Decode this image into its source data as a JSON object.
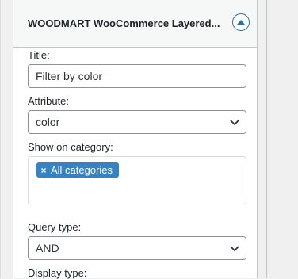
{
  "widget": {
    "title": "WOODMART WooCommerce Layered...",
    "toggle_icon": "chevron-up-icon"
  },
  "form": {
    "title_label": "Title:",
    "title_value": "Filter by color",
    "attribute_label": "Attribute:",
    "attribute_value": "color",
    "category_label": "Show on category:",
    "category_tags": [
      {
        "label": "All categories",
        "remove_symbol": "×"
      }
    ],
    "query_type_label": "Query type:",
    "query_type_value": "AND",
    "display_type_label": "Display type:"
  },
  "colors": {
    "accent": "#2271b1",
    "tag_bg": "#3582c4",
    "border": "#8c8f94",
    "background": "#f0f0f1"
  }
}
